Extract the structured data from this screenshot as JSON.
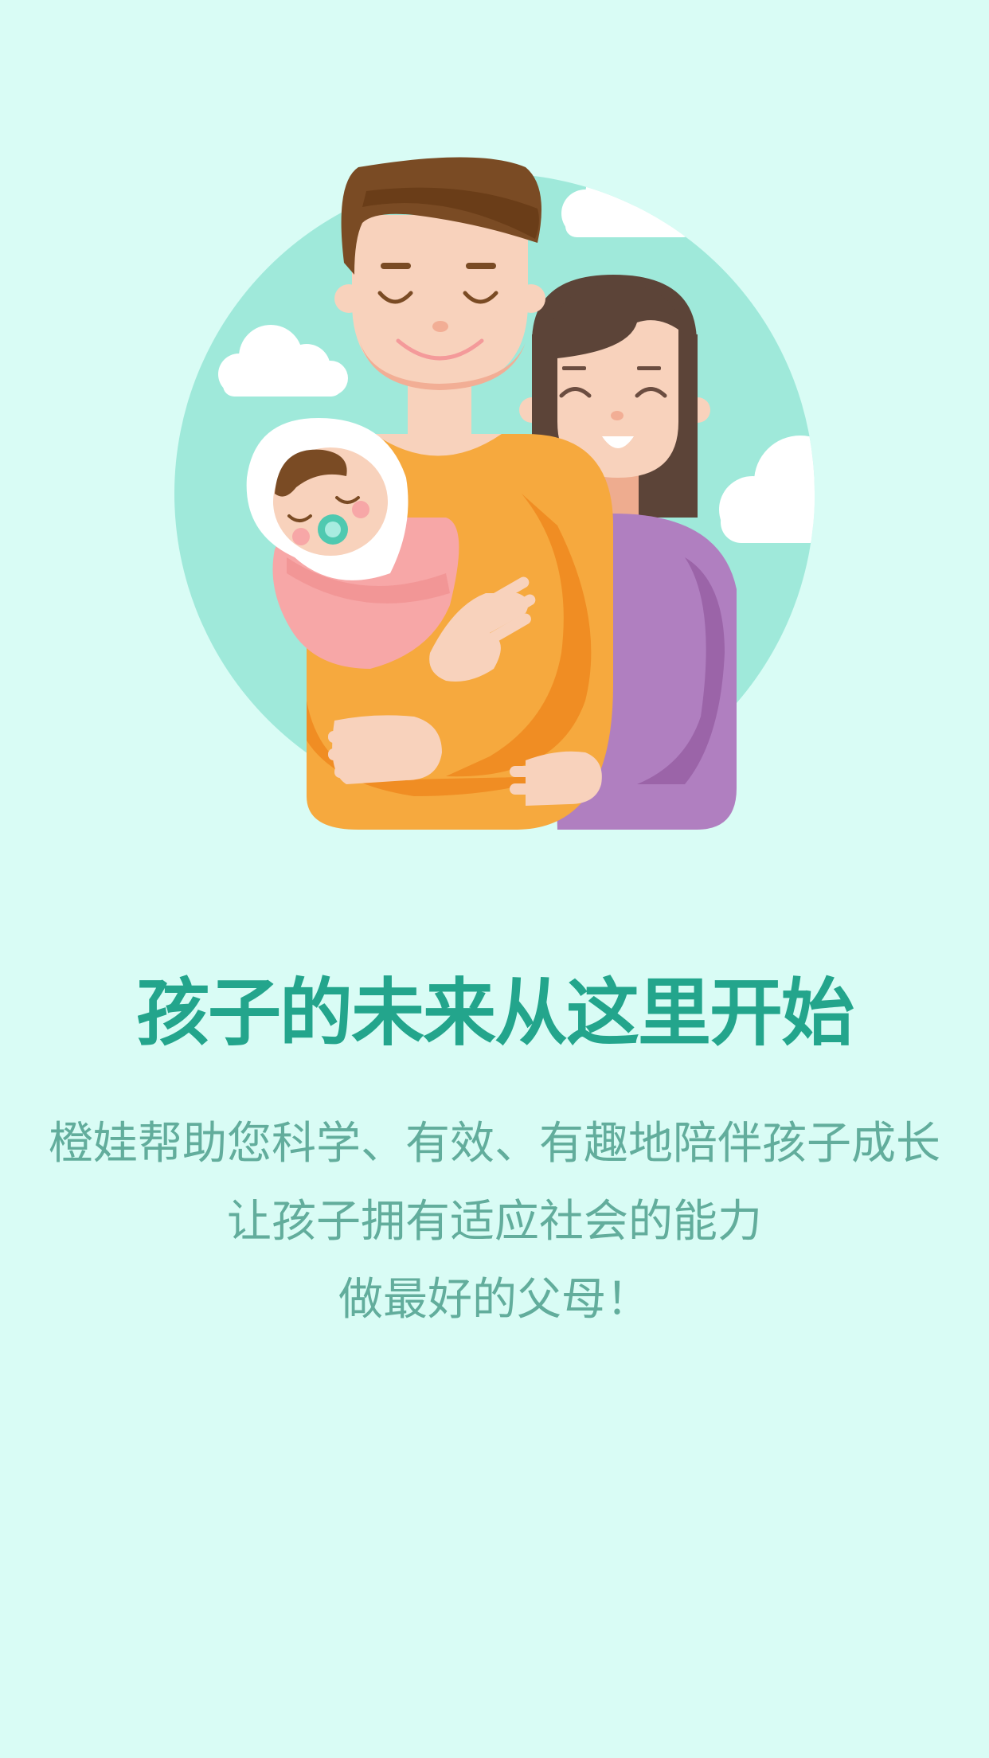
{
  "onboarding": {
    "illustration": {
      "description_icon": "family-illustration",
      "colors": {
        "circle": "#9fe9da",
        "father_shirt": "#f6a93e",
        "mother_shirt": "#b07fc0",
        "skin": "#f8d2bc",
        "baby_blanket": "#f7a7a7",
        "hair_father": "#7a4b24",
        "hair_mother": "#5c4438"
      }
    },
    "title": "孩子的未来从这里开始",
    "lines": [
      "橙娃帮助您科学、有效、有趣地陪伴孩子成长",
      "让孩子拥有适应社会的能力",
      "做最好的父母！"
    ]
  },
  "theme": {
    "background": "#d9fcf5",
    "title_color": "#23a58c",
    "body_color": "#62ad9c"
  }
}
